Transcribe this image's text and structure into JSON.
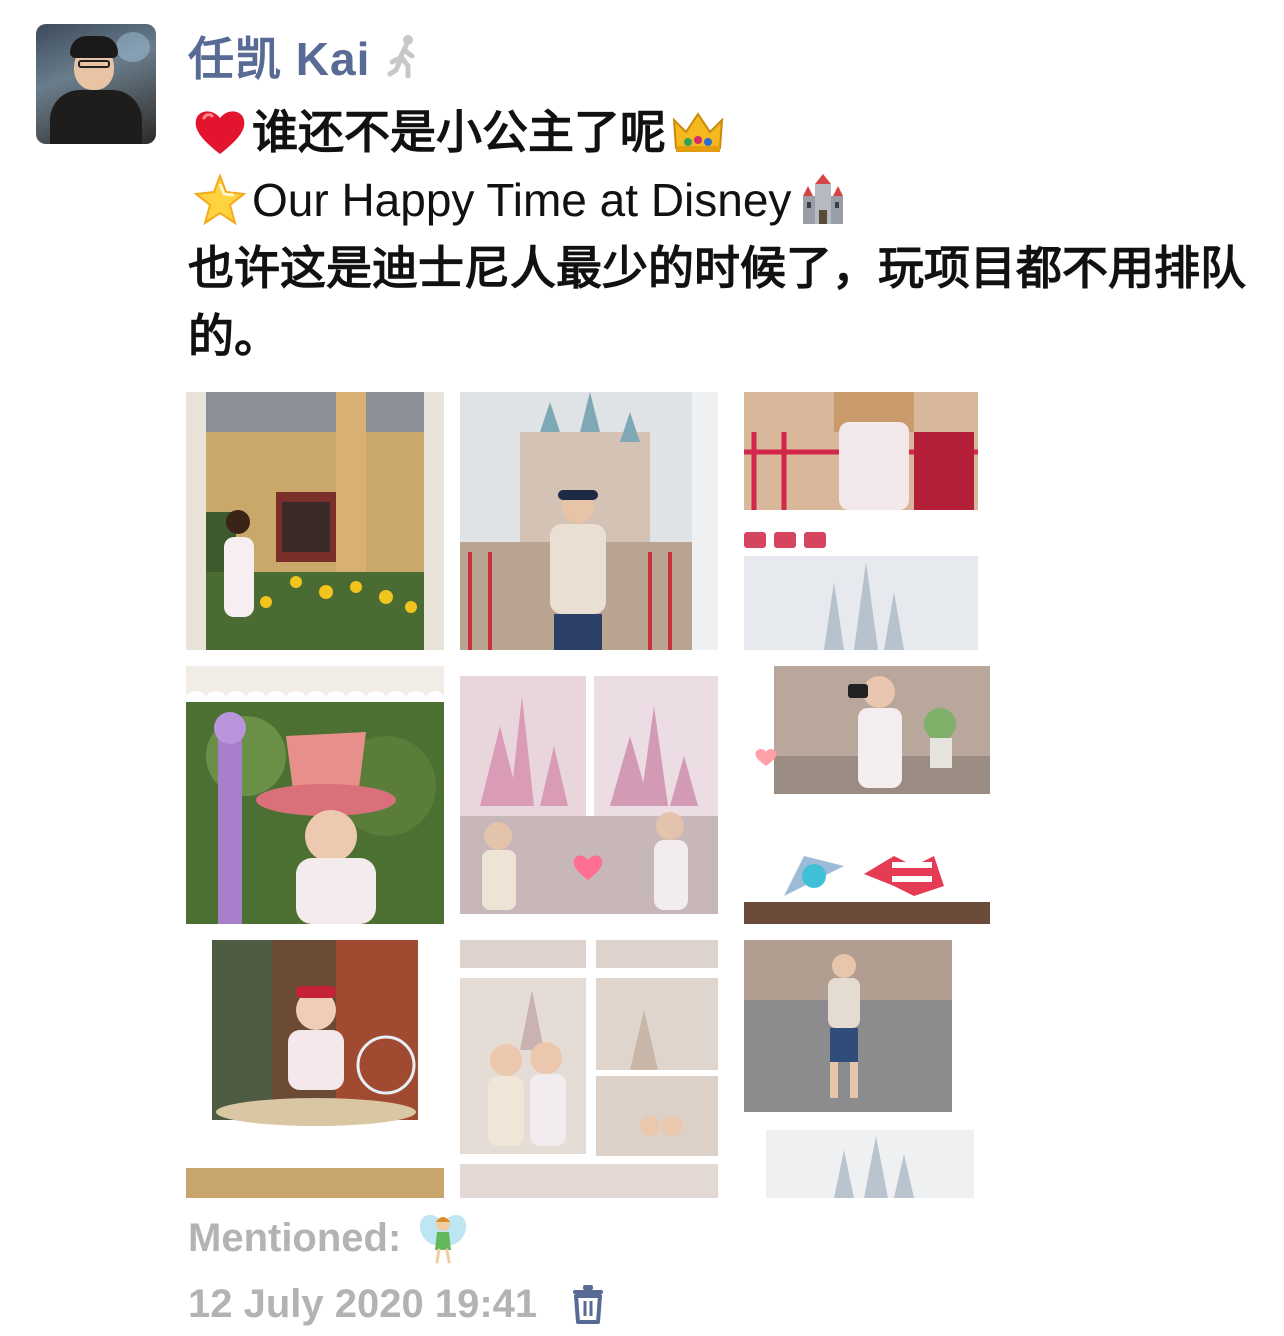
{
  "post": {
    "author": "任凯 Kai",
    "lines": {
      "line1": "谁还不是小公主了呢",
      "line2": "Our Happy Time at Disney",
      "line3": "也许这是迪士尼人最少的时候了，玩项目都不用排队的。"
    },
    "mentioned_label": "Mentioned:",
    "timestamp": "12 July 2020 19:41"
  },
  "icons": {
    "author_status": "walking-person-icon",
    "line1_prefix": "red-heart-icon",
    "line1_suffix": "crown-icon",
    "line2_prefix": "glowing-star-icon",
    "line2_suffix": "castle-icon",
    "mentioned": "fairy-icon",
    "delete": "trash-icon"
  },
  "photos_count": 9,
  "colors": {
    "author_name": "#576b95",
    "meta_text": "#b3b3b3",
    "body_text": "#111111",
    "trash": "#576b95"
  }
}
